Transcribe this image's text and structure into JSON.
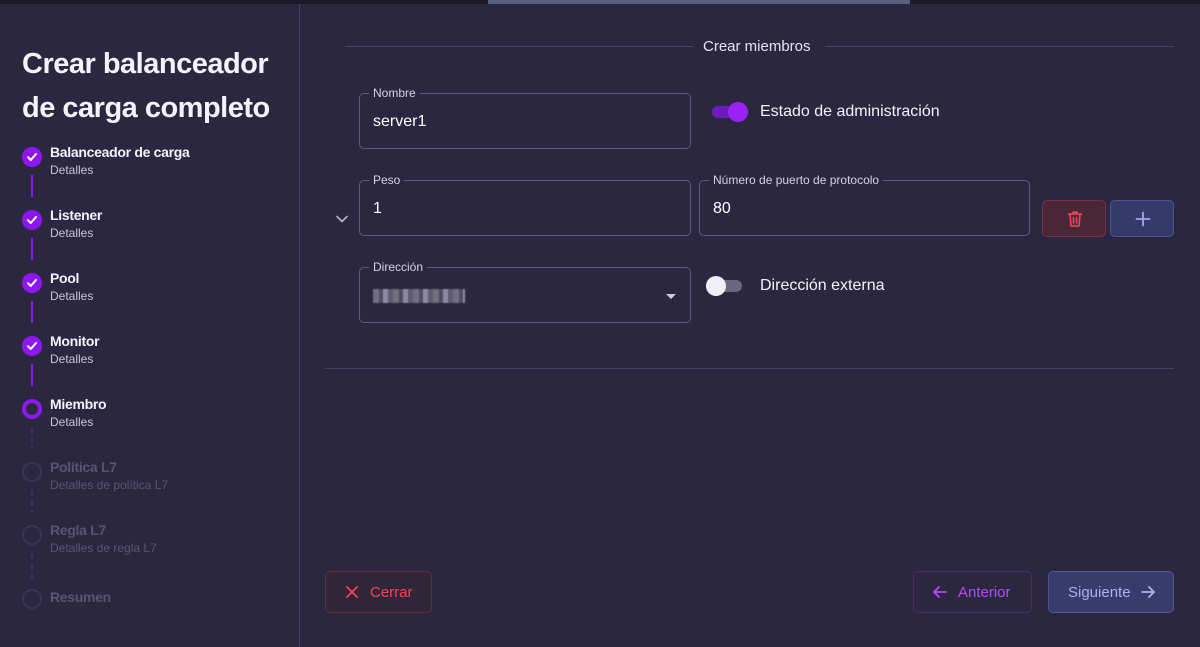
{
  "wizard": {
    "title": "Crear balanceador de carga completo",
    "steps": [
      {
        "label": "Balanceador de carga",
        "sub": "Detalles",
        "state": "done"
      },
      {
        "label": "Listener",
        "sub": "Detalles",
        "state": "done"
      },
      {
        "label": "Pool",
        "sub": "Detalles",
        "state": "done"
      },
      {
        "label": "Monitor",
        "sub": "Detalles",
        "state": "done"
      },
      {
        "label": "Miembro",
        "sub": "Detalles",
        "state": "current"
      },
      {
        "label": "Política L7",
        "sub": "Detalles de política L7",
        "state": "pending"
      },
      {
        "label": "Regla L7",
        "sub": "Detalles de regla L7",
        "state": "pending"
      },
      {
        "label": "Resumen",
        "sub": "",
        "state": "pending"
      }
    ]
  },
  "form": {
    "section_title": "Crear miembros",
    "nombre": {
      "label": "Nombre",
      "value": "server1"
    },
    "admin_state": {
      "label": "Estado de administración",
      "on": true
    },
    "peso": {
      "label": "Peso",
      "value": "1"
    },
    "puerto": {
      "label": "Número de puerto de protocolo",
      "value": "80"
    },
    "direccion": {
      "label": "Dirección"
    },
    "external": {
      "label": "Dirección externa",
      "on": false
    }
  },
  "footer": {
    "close_label": "Cerrar",
    "prev_label": "Anterior",
    "next_label": "Siguiente"
  },
  "colors": {
    "accent": "#8e17f0",
    "danger": "#f5435a",
    "background": "#2b2740"
  }
}
